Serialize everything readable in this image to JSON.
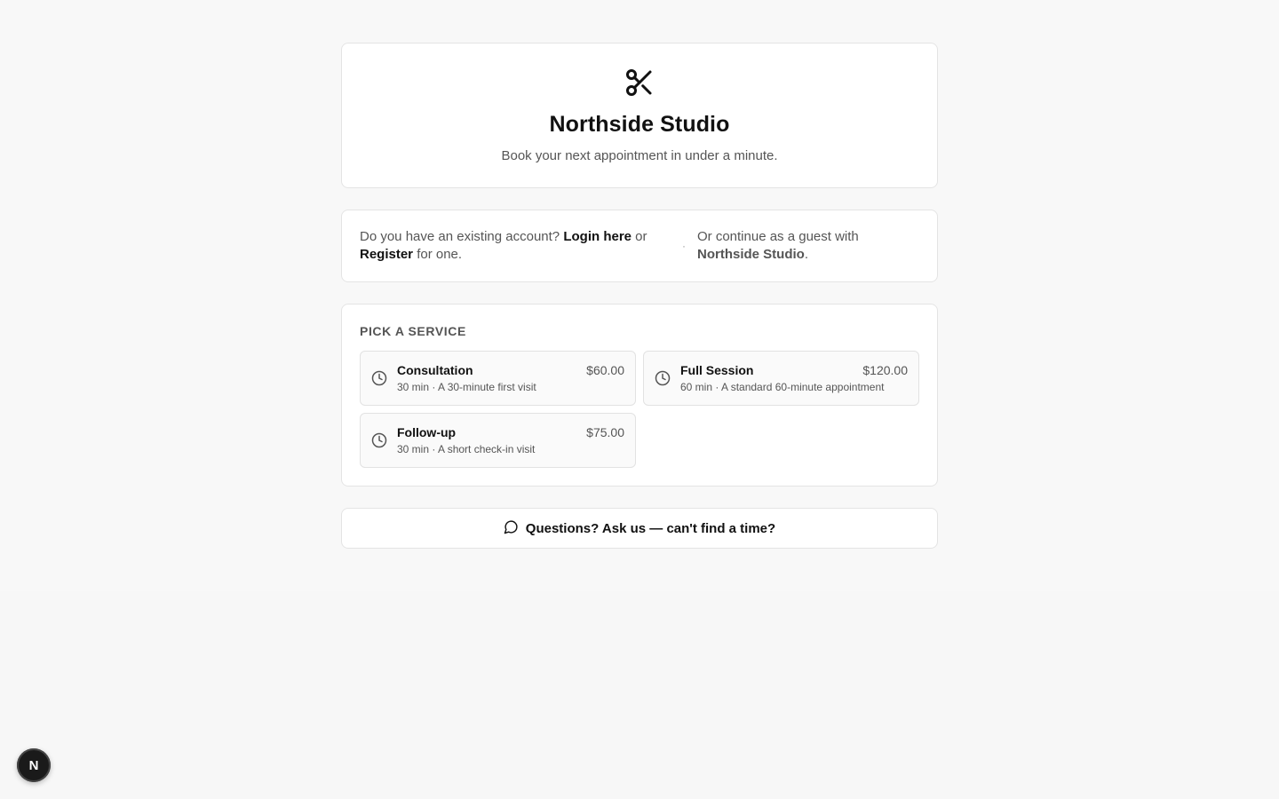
{
  "header": {
    "icon": "scissors-icon",
    "title": "Northside Studio",
    "subtitle": "Book your next appointment in under a minute."
  },
  "account": {
    "prompt": "Do you have an existing account?",
    "login_link": "Login here",
    "or_text": "or",
    "register_link": "Register",
    "for_one": "for one.",
    "separator": "·",
    "guest_text": "Or continue as a guest with",
    "guest_brand": "Northside Studio",
    "guest_period": "."
  },
  "services": {
    "label": "PICK A SERVICE",
    "items": [
      {
        "name": "Consultation",
        "price": "$60.00",
        "desc": "30 min · A 30-minute first visit",
        "icon": "clock-icon"
      },
      {
        "name": "Full Session",
        "price": "$120.00",
        "desc": "60 min · A standard 60-minute appointment",
        "icon": "clock-icon"
      },
      {
        "name": "Follow-up",
        "price": "$75.00",
        "desc": "30 min · A short check-in visit",
        "icon": "clock-icon"
      }
    ]
  },
  "questions": {
    "icon": "chat-bubble-icon",
    "label": "Questions? Ask us — can't find a time?"
  },
  "badge": {
    "letter": "N"
  },
  "colors": {
    "background": "#f8f8f8",
    "card": "#ffffff",
    "border": "#e4e4e4",
    "text": "#111111",
    "muted": "#555555"
  }
}
